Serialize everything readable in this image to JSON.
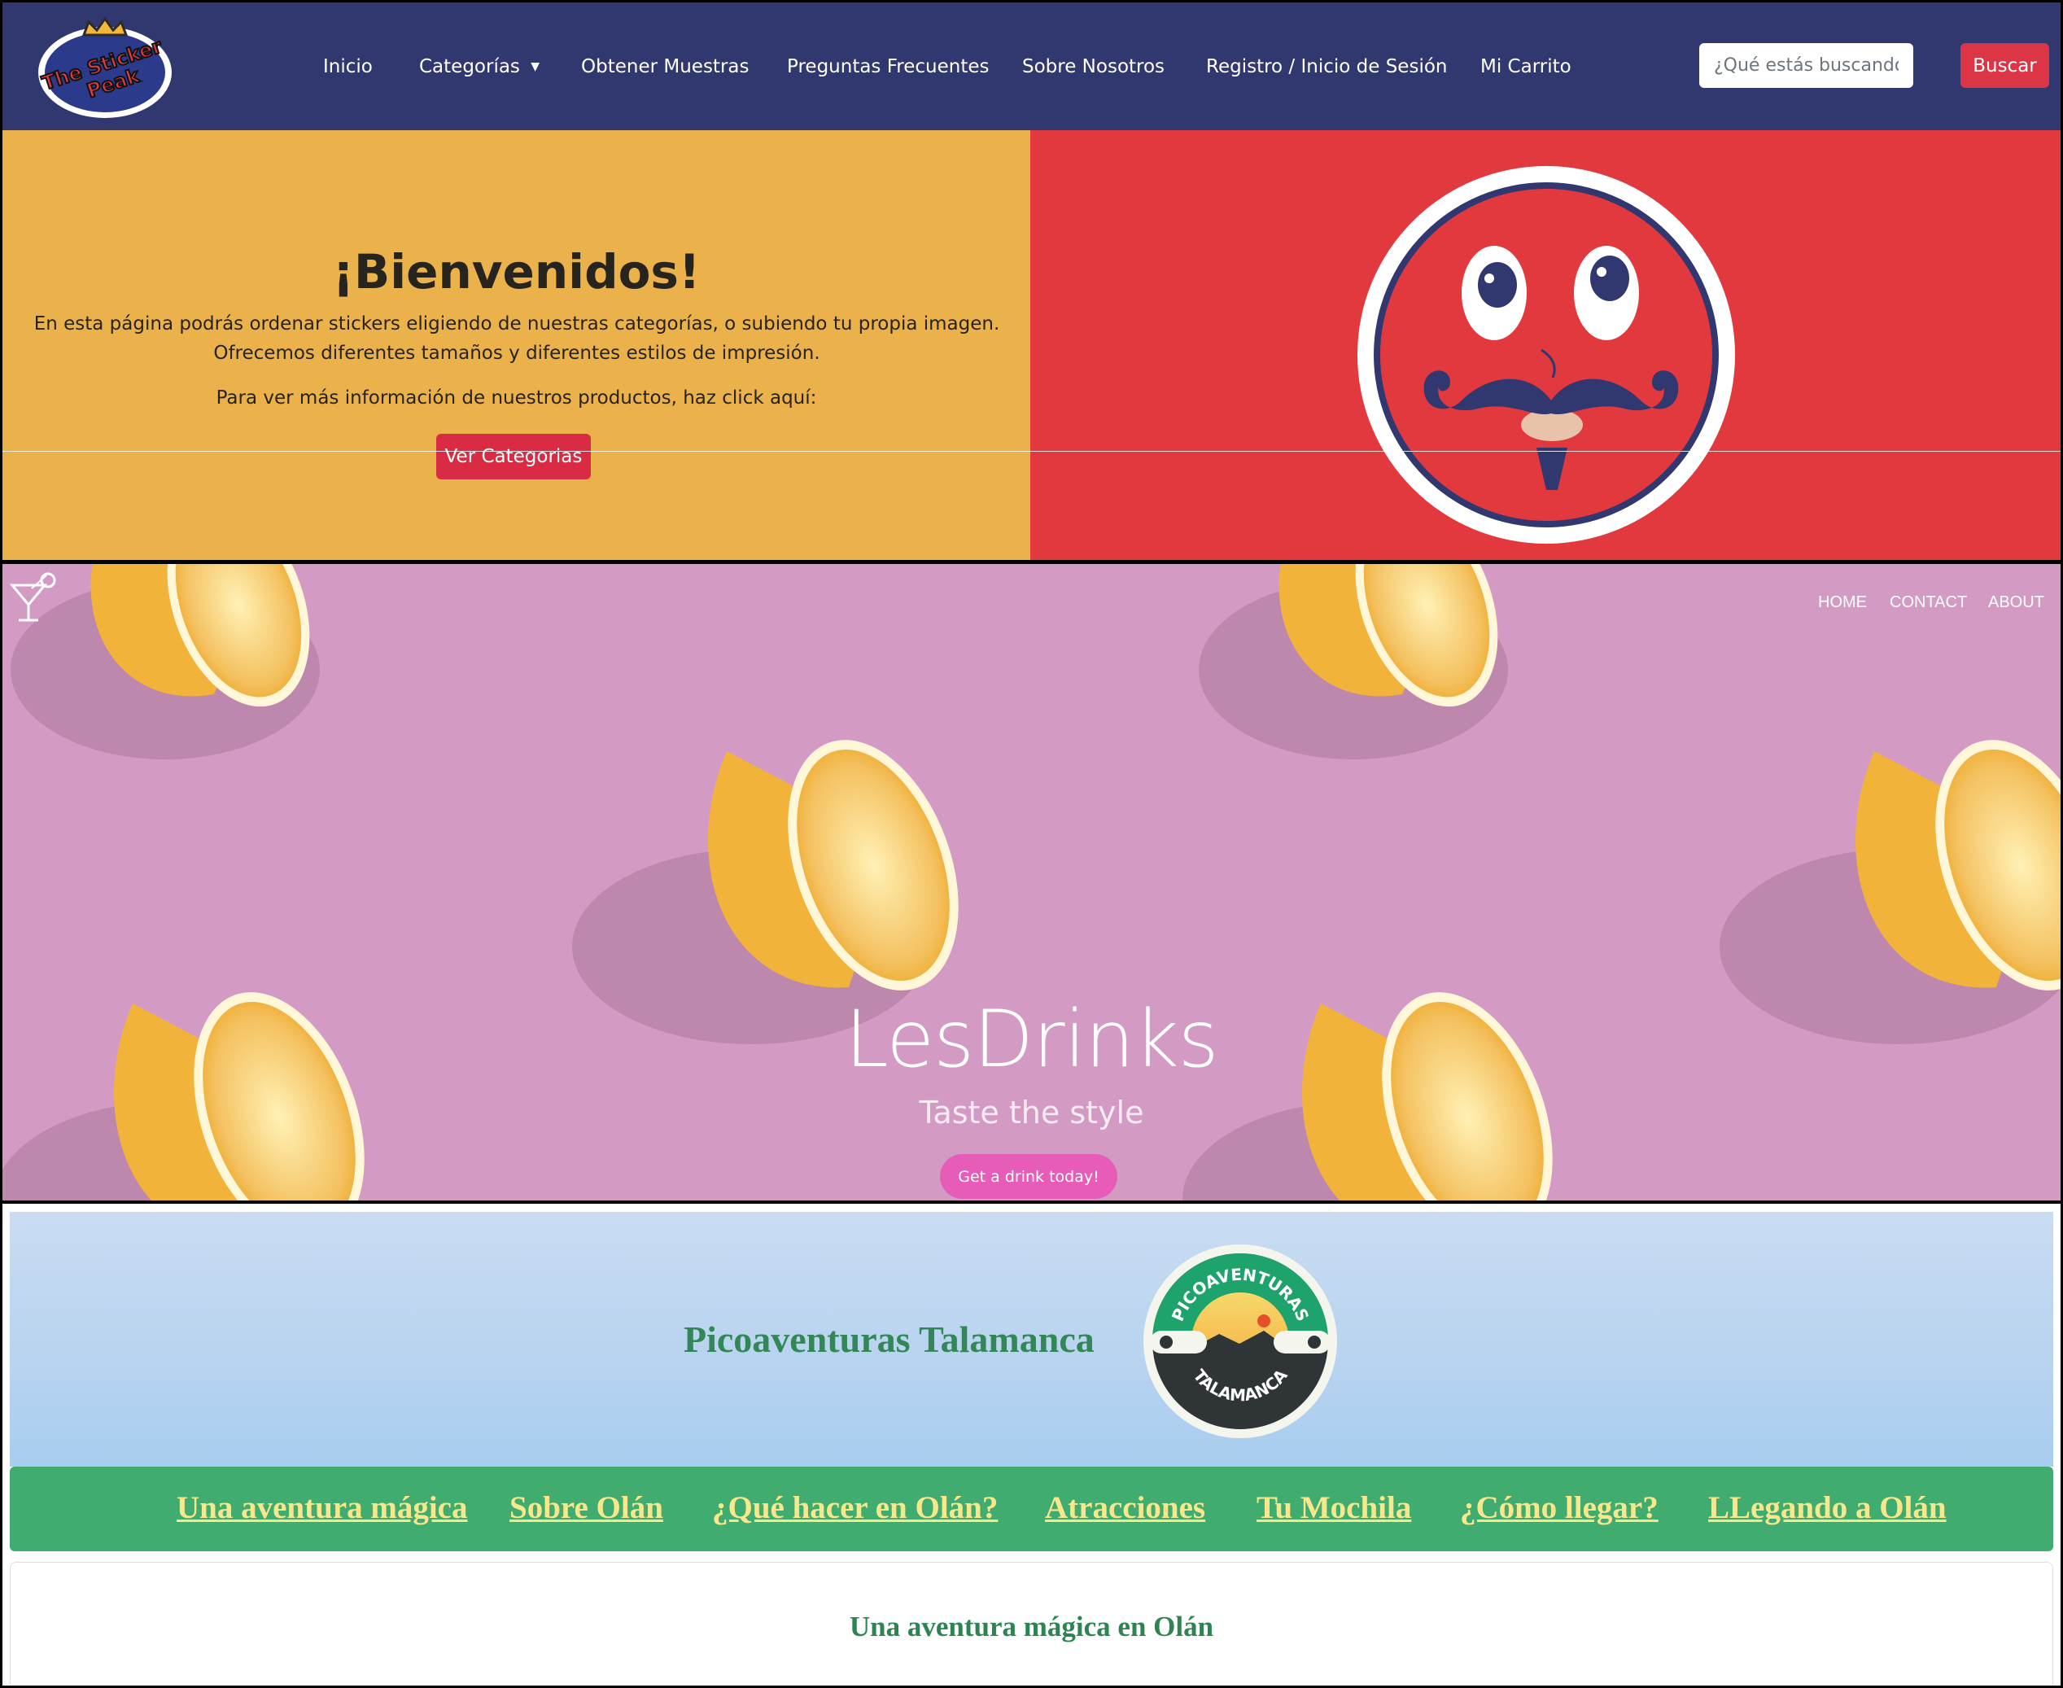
{
  "sticker_site": {
    "logo_text": "The Sticker Peak",
    "nav_links": [
      "Inicio",
      "Categorías",
      "Obtener Muestras",
      "Preguntas Frecuentes",
      "Sobre Nosotros",
      "Registro / Inicio de Sesión",
      "Mi Carrito"
    ],
    "search_placeholder": "¿Qué estás buscando?",
    "search_button": "Buscar",
    "hero_title": "¡Bienvenidos!",
    "hero_text": "En esta página podrás ordenar stickers eligiendo de nuestras categorías, o subiendo tu propia imagen. Ofrecemos diferentes tamaños y diferentes estilos de impresión.",
    "hero_text2": "Para ver más información de nuestros productos, haz click aquí:",
    "hero_button": "Ver Categorias",
    "colors": {
      "nav": "#31386f",
      "left_panel": "#ebb14b",
      "right_panel": "#e2393e",
      "button": "#dc3545"
    }
  },
  "drinks_site": {
    "nav_links": [
      "HOME",
      "CONTACT",
      "ABOUT"
    ],
    "title": "LesDrinks",
    "subtitle": "Taste the style",
    "button": "Get a drink today!",
    "logo_icon": "cocktail-glass-icon",
    "colors": {
      "background": "#d39bc3",
      "button": "#e75bb9",
      "lemon": "#f2b33a"
    }
  },
  "pico_site": {
    "title": "Picoaventuras Talamanca",
    "badge_top_text": "PICOAVENTURAS",
    "badge_bottom_text": "TALAMANCA",
    "nav_links": [
      "Una aventura mágica",
      "Sobre Olán",
      "¿Qué hacer en Olán?",
      "Atracciones",
      "Tu Mochila",
      "¿Cómo llegar?",
      "LLegando a Olán"
    ],
    "section_title": "Una aventura mágica en Olán",
    "colors": {
      "title": "#318756",
      "nav": "#41ac6f",
      "nav_link": "#f9e78c",
      "sky": "#b9d4f0"
    }
  }
}
